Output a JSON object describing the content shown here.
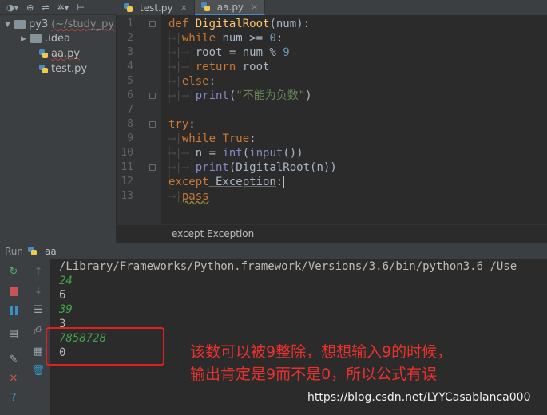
{
  "project": {
    "root_label": "py3",
    "root_path": "(~/study_py",
    "items": [
      {
        "label": ".idea"
      },
      {
        "label": "aa.py"
      },
      {
        "label": "test.py"
      }
    ]
  },
  "tabs": [
    {
      "label": "test.py",
      "active": false
    },
    {
      "label": "aa.py",
      "active": true
    }
  ],
  "editor": {
    "line_numbers": [
      "1",
      "2",
      "3",
      "4",
      "5",
      "6",
      "7",
      "8",
      "9",
      "10",
      "11",
      "12",
      "13"
    ],
    "lines": {
      "l1_kw": "def",
      "l1_fn": "DigitalRoot",
      "l1_rest": "(num):",
      "l2_kw": "while",
      "l2_a": " num >= ",
      "l2_num": "0",
      "l2_b": ":",
      "l3_a": "root = num % ",
      "l3_num": "9",
      "l4_kw": "return",
      "l4_rest": " root",
      "l5_kw": "else",
      "l5_rest": ":",
      "l6_bi": "print",
      "l6_a": "(",
      "l6_str": "\"不能为负数\"",
      "l6_b": ")",
      "l8_kw": "try",
      "l8_rest": ":",
      "l9_kw1": "while",
      "l9_kw2": " True",
      "l9_rest": ":",
      "l10_a": "n = ",
      "l10_bi1": "int",
      "l10_b": "(",
      "l10_bi2": "input",
      "l10_c": "())",
      "l11_bi": "print",
      "l11_rest": "(DigitalRoot(n))",
      "l12_kw": "except",
      "l12_cls": " Exception",
      "l12_rest": ":",
      "l13_kw": "pass"
    }
  },
  "breadcrumb": "except Exception",
  "run": {
    "label": "Run",
    "config": "aa"
  },
  "console": {
    "command": "/Library/Frameworks/Python.framework/Versions/3.6/bin/python3.6 /Use",
    "lines": [
      {
        "text": "24",
        "kind": "input"
      },
      {
        "text": "6",
        "kind": "output"
      },
      {
        "text": "39",
        "kind": "input"
      },
      {
        "text": "3",
        "kind": "output"
      },
      {
        "text": "7858728",
        "kind": "input"
      },
      {
        "text": "0",
        "kind": "output"
      }
    ]
  },
  "annotation": {
    "line1": "该数可以被9整除，想想输入9的时候，",
    "line2": "输出肯定是9而不是0，所以公式有误"
  },
  "watermark": "https://blog.csdn.net/LYYCasablanca000",
  "colors": {
    "keyword": "#cc7832",
    "function": "#ffc66d",
    "number": "#6897bb",
    "string": "#6a8759",
    "builtin": "#8888c6",
    "user_input": "#44a148",
    "annotation_red": "#e2211c"
  },
  "icons": [
    "project-icon",
    "target-icon",
    "split-icon",
    "gear-icon",
    "collapse-icon",
    "rerun-icon",
    "stop-icon",
    "pause-icon",
    "scroll-up-icon",
    "scroll-down-icon",
    "print-icon",
    "settings-icon",
    "trash-icon",
    "pin-icon",
    "close-icon",
    "help-icon"
  ]
}
